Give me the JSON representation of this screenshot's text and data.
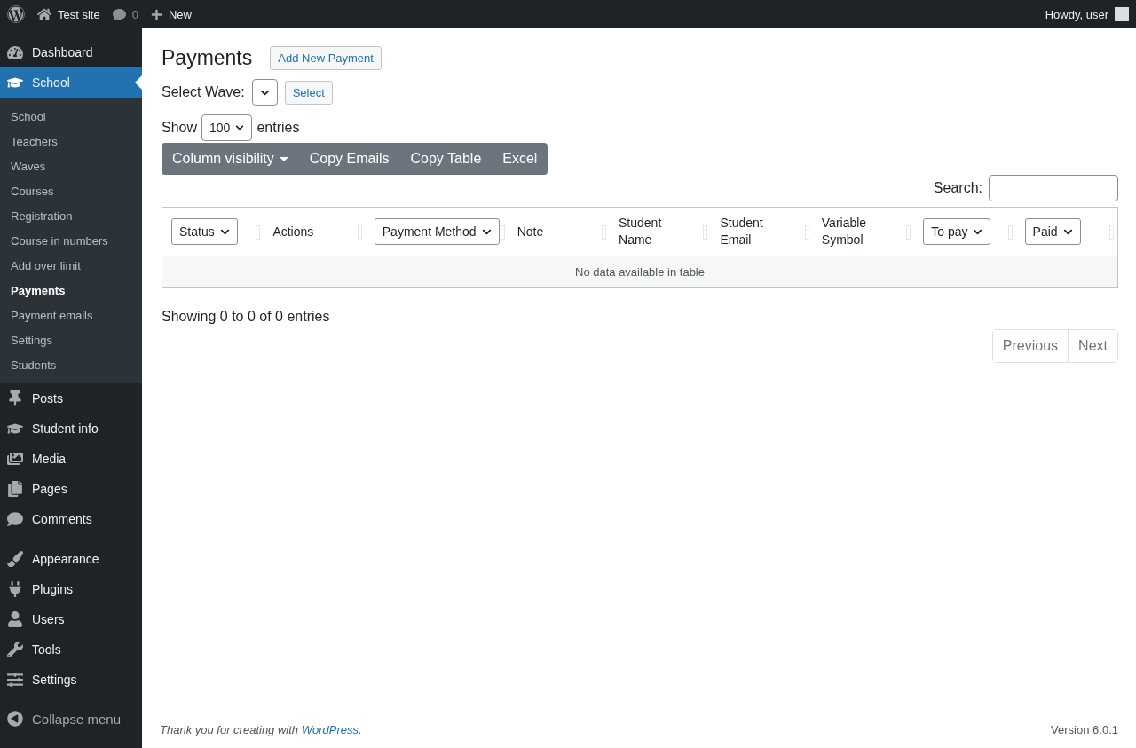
{
  "admin_bar": {
    "site": "Test site",
    "comments": "0",
    "new": "New",
    "greeting": "Howdy, user"
  },
  "sidebar": {
    "items": [
      {
        "label": "Dashboard",
        "selected": false
      },
      {
        "label": "School",
        "selected": true,
        "children": [
          {
            "label": "School",
            "selected": false
          },
          {
            "label": "Teachers",
            "selected": false
          },
          {
            "label": "Waves",
            "selected": false
          },
          {
            "label": "Courses",
            "selected": false
          },
          {
            "label": "Registration",
            "selected": false
          },
          {
            "label": "Course in numbers",
            "selected": false
          },
          {
            "label": "Add over limit",
            "selected": false
          },
          {
            "label": "Payments",
            "selected": true
          },
          {
            "label": "Payment emails",
            "selected": false
          },
          {
            "label": "Settings",
            "selected": false
          },
          {
            "label": "Students",
            "selected": false
          }
        ]
      },
      {
        "label": "Posts",
        "selected": false
      },
      {
        "label": "Student info",
        "selected": false
      },
      {
        "label": "Media",
        "selected": false
      },
      {
        "label": "Pages",
        "selected": false
      },
      {
        "label": "Comments",
        "selected": false
      },
      {
        "label": "Appearance",
        "selected": false
      },
      {
        "label": "Plugins",
        "selected": false
      },
      {
        "label": "Users",
        "selected": false
      },
      {
        "label": "Tools",
        "selected": false
      },
      {
        "label": "Settings",
        "selected": false
      }
    ],
    "collapse": "Collapse menu"
  },
  "page": {
    "title": "Payments",
    "add_button": "Add New Payment",
    "wave_label": "Select Wave:",
    "select_button": "Select",
    "show_label": "Show",
    "entries_value": "100",
    "entries_label": "entries",
    "toolbar": [
      {
        "label": "Column visibility",
        "kind": "dropdown"
      },
      {
        "label": "Copy Emails",
        "kind": "button"
      },
      {
        "label": "Copy Table",
        "kind": "button"
      },
      {
        "label": "Excel",
        "kind": "button"
      }
    ],
    "search_label": "Search:"
  },
  "table": {
    "columns": [
      {
        "label": "Status",
        "kind": "select"
      },
      {
        "label": "Actions",
        "kind": "text"
      },
      {
        "label": "Payment Method",
        "kind": "select"
      },
      {
        "label": "Note",
        "kind": "text"
      },
      {
        "label": "Student Name",
        "kind": "text"
      },
      {
        "label": "Student Email",
        "kind": "text"
      },
      {
        "label": "Variable Symbol",
        "kind": "text"
      },
      {
        "label": "To pay",
        "kind": "select"
      },
      {
        "label": "Paid",
        "kind": "select"
      }
    ],
    "empty": "No data available in table"
  },
  "info": "Showing 0 to 0 of 0 entries",
  "pagination": [
    "Previous",
    "Next"
  ],
  "footer": {
    "thanks": "Thank you for creating with ",
    "link": "WordPress",
    "period": ".",
    "version": "Version 6.0.1"
  }
}
